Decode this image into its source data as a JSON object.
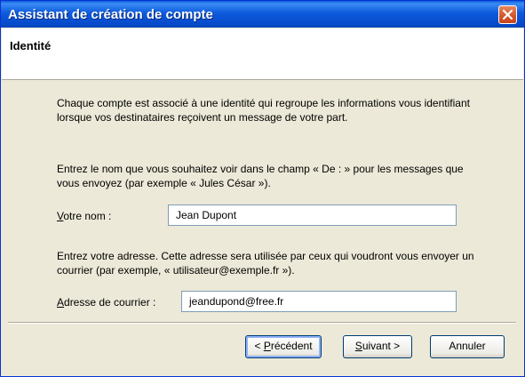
{
  "window": {
    "title": "Assistant de création de compte"
  },
  "page": {
    "title": "Identité"
  },
  "content": {
    "intro": "Chaque compte est associé à une identité qui regroupe les informations vous identifiant lorsque vos destinataires reçoivent un message de votre part.",
    "name_help": "Entrez le nom que vous souhaitez voir dans le champ « De : » pour les messages que vous envoyez (par exemple « Jules César »).",
    "name_label_first": "V",
    "name_label_rest": "otre nom :",
    "name_value": "Jean Dupont",
    "email_help": "Entrez votre adresse. Cette adresse sera utilisée par ceux qui voudront vous envoyer un courrier (par exemple, « utilisateur@exemple.fr »).",
    "email_label_first": "A",
    "email_label_rest": "dresse de courrier :",
    "email_value": "jeandupond@free.fr"
  },
  "buttons": {
    "back_prefix": "< ",
    "back_key": "P",
    "back_rest": "récédent",
    "next_key": "S",
    "next_rest": "uivant >",
    "cancel": "Annuler"
  }
}
